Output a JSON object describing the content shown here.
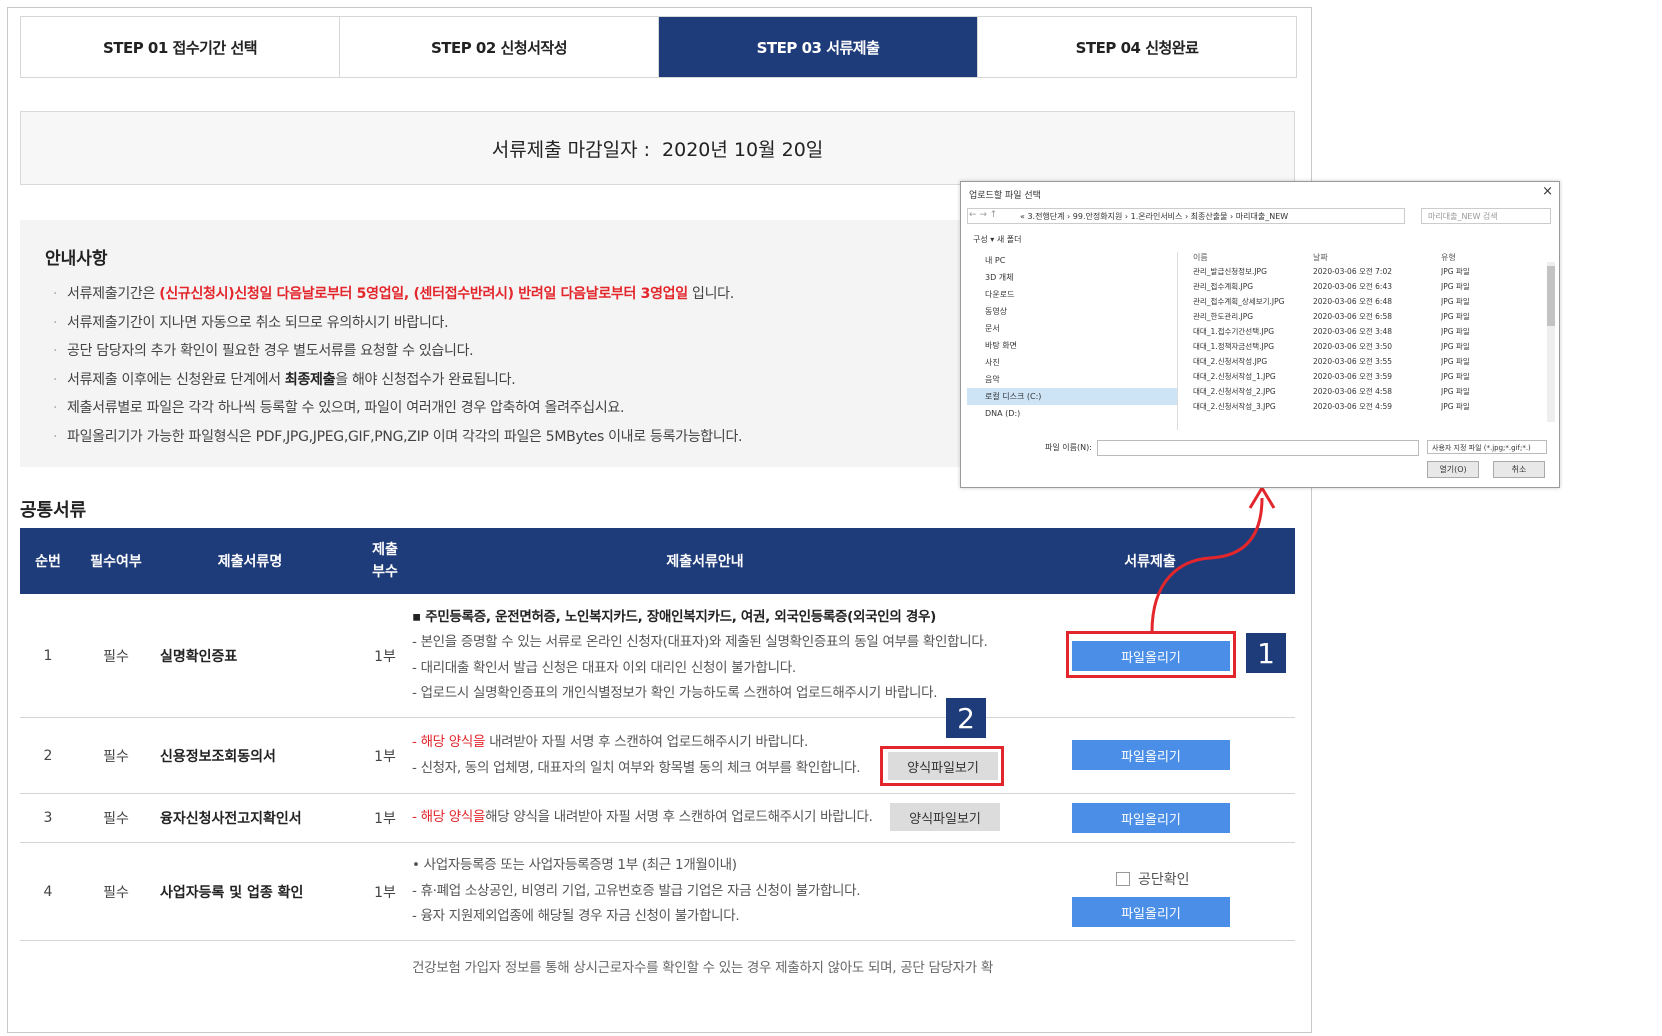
{
  "steps": [
    {
      "label": "STEP 01 접수기간 선택"
    },
    {
      "label": "STEP 02 신청서작성"
    },
    {
      "label": "STEP 03 서류제출"
    },
    {
      "label": "STEP 04 신청완료"
    }
  ],
  "deadline": {
    "label": "서류제출 마감일자 :",
    "date": "2020년 10월 20일"
  },
  "notice": {
    "title": "안내사항",
    "line1_pre": "서류제출기간은 ",
    "line1_red": "(신규신청시)신청일 다음날로부터 5영업일, (센터접수반려시) 반려일 다음날로부터 3영업일",
    "line1_post": " 입니다.",
    "line2": "서류제출기간이 지나면 자동으로 취소 되므로 유의하시기 바랍니다.",
    "line3": "공단 담당자의 추가 확인이 필요한 경우 별도서류를 요청할 수 있습니다.",
    "line4_pre": "서류제출 이후에는 신청완료 단계에서 ",
    "line4_bold": "최종제출",
    "line4_post": "을 해야 신청접수가 완료됩니다.",
    "line5": "제출서류별로 파일은 각각 하나씩 등록할 수 있으며, 파일이 여러개인 경우 압축하여 올려주십시요.",
    "line6": "파일올리기가 가능한 파일형식은 PDF,JPG,JPEG,GIF,PNG,ZIP 이며 각각의 파일은 5MBytes 이내로 등록가능합니다."
  },
  "section_title": "공통서류",
  "table": {
    "headers": {
      "no": "순번",
      "required": "필수여부",
      "name": "제출서류명",
      "count_line1": "제출",
      "count_line2": "부수",
      "guide": "제출서류안내",
      "submit": "서류제출"
    },
    "rows": [
      {
        "no": "1",
        "required": "필수",
        "name": "실명확인증표",
        "count": "1부",
        "head": "▪ 주민등록증, 운전면허증, 노인복지카드, 장애인복지카드, 여권, 외국인등록증(외국인의 경우)",
        "g1": "- 본인을 증명할 수 있는 서류로 온라인 신청자(대표자)와 제출된 실명확인증표의 동일 여부를 확인합니다.",
        "g2": "- 대리대출 확인서 발급 신청은 대표자 이외 대리인 신청이 불가합니다.",
        "g3": "- 업로드시 실명확인증표의 개인식별정보가 확인 가능하도록 스캔하여 업로드해주시기 바랍니다."
      },
      {
        "no": "2",
        "required": "필수",
        "name": "신용정보조회동의서",
        "count": "1부",
        "g1_red": "- 해당 양식을",
        "g1": " 내려받아 자필 서명 후 스캔하여 업로드해주시기 바랍니다.",
        "g2": "- 신청자, 동의 업체명, 대표자의 일치 여부와 항목별 동의 체크 여부를 확인합니다."
      },
      {
        "no": "3",
        "required": "필수",
        "name": "융자신청사전고지확인서",
        "count": "1부",
        "g1_red": "- 해당 양식을",
        "g1": "해당 양식을 내려받아 자필 서명 후 스캔하여 업로드해주시기 바랍니다."
      },
      {
        "no": "4",
        "required": "필수",
        "name": "사업자등록 및 업종 확인",
        "count": "1부",
        "head": "• 사업자등록증 또는 사업자등록증명 1부 (최근 1개월이내)",
        "g1": "- 휴·폐업 소상공인, 비영리 기업, 고유번호증 발급 기업은 자금 신청이 불가합니다.",
        "g2": "- 융자 지원제외업종에 해당될 경우 자금 신청이 불가합니다.",
        "checkbox": "공단확인"
      }
    ],
    "partial_row": "건강보험 가입자 정보를 통해 상시근로자수를 확인할 수 있는 경우 제출하지 않아도 되며, 공단 담당자가 확"
  },
  "buttons": {
    "upload": "파일올리기",
    "form_view": "양식파일보기"
  },
  "badges": {
    "one": "1",
    "two": "2"
  },
  "dialog": {
    "title": "업로드할 파일 선택",
    "close": "×",
    "nav": "← → ↑",
    "path": "« 3.전행단계 › 99.안정화지원 › 1.온라인서비스 › 최종산출물 › 마리대출_NEW",
    "search_placeholder": "마리대출_NEW 검색",
    "toolbar": "구성 ▾     새 폴더",
    "tree": [
      "내 PC",
      "3D 개체",
      "다운로드",
      "동영상",
      "문서",
      "바탕 화면",
      "사진",
      "음악",
      "로컬 디스크 (C:)",
      "DNA (D:)"
    ],
    "col_name": "이름",
    "col_date": "날짜",
    "col_type": "유형",
    "files": [
      {
        "name": "관리_발급신청정보.JPG",
        "date": "2020-03-06 오전 7:02",
        "type": "JPG 파일"
      },
      {
        "name": "관리_접수계획.JPG",
        "date": "2020-03-06 오전 6:43",
        "type": "JPG 파일"
      },
      {
        "name": "관리_접수계획_상세보기.JPG",
        "date": "2020-03-06 오전 6:48",
        "type": "JPG 파일"
      },
      {
        "name": "관리_한도관리.JPG",
        "date": "2020-03-06 오전 6:58",
        "type": "JPG 파일"
      },
      {
        "name": "대대_1.접수기간선택.JPG",
        "date": "2020-03-06 오전 3:48",
        "type": "JPG 파일"
      },
      {
        "name": "대대_1.정책자금선택.JPG",
        "date": "2020-03-06 오전 3:50",
        "type": "JPG 파일"
      },
      {
        "name": "대대_2.신청서작성.JPG",
        "date": "2020-03-06 오전 3:55",
        "type": "JPG 파일"
      },
      {
        "name": "대대_2.신청서작성_1.JPG",
        "date": "2020-03-06 오전 3:59",
        "type": "JPG 파일"
      },
      {
        "name": "대대_2.신청서작성_2.JPG",
        "date": "2020-03-06 오전 4:58",
        "type": "JPG 파일"
      },
      {
        "name": "대대_2.신청서작성_3.JPG",
        "date": "2020-03-06 오전 4:59",
        "type": "JPG 파일"
      }
    ],
    "filename_label": "파일 이름(N):",
    "filetype": "사용자 지정 파일 (*.jpg;*.gif;*.)",
    "open": "열기(O)",
    "cancel": "취소"
  },
  "colors": {
    "navy": "#1f3c7a",
    "upload_blue": "#4a8ee8",
    "highlight_red": "#e3262c"
  }
}
